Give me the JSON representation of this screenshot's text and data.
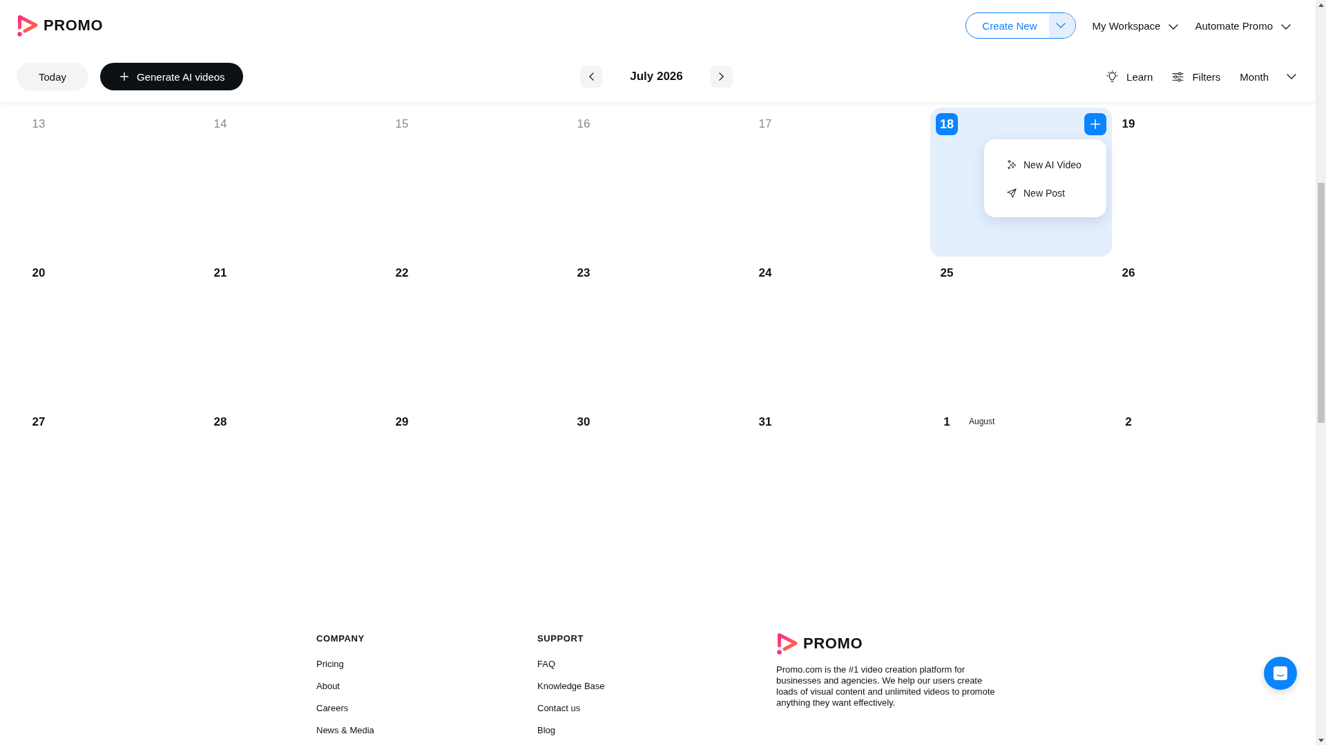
{
  "header": {
    "logo": "PROMO",
    "create_button": "Create New",
    "menus": [
      {
        "label": "My Workspace"
      },
      {
        "label": "Automate Promo"
      }
    ]
  },
  "toolbar": {
    "today_button": "Today",
    "generate_button": "Generate AI videos",
    "month_title": "July 2026",
    "actions": [
      {
        "kind": "learn",
        "label": "Learn"
      },
      {
        "kind": "filters",
        "label": "Filters"
      }
    ],
    "view_select": "Month"
  },
  "calendar": {
    "weeks": [
      {
        "days": [
          {
            "day": "13",
            "past": true,
            "today": false,
            "selected": false
          },
          {
            "day": "14",
            "past": true,
            "today": false,
            "selected": false
          },
          {
            "day": "15",
            "past": true,
            "today": false,
            "selected": false
          },
          {
            "day": "16",
            "past": true,
            "today": false,
            "selected": false
          },
          {
            "day": "17",
            "past": true,
            "today": false,
            "selected": false
          },
          {
            "day": "18",
            "past": false,
            "today": true,
            "selected": true,
            "menu": [
              {
                "kind": "ai_video",
                "label": "New AI Video"
              },
              {
                "kind": "post",
                "label": "New Post"
              }
            ]
          },
          {
            "day": "19",
            "past": false,
            "today": false,
            "selected": false
          }
        ]
      },
      {
        "days": [
          {
            "day": "20",
            "past": false,
            "today": false,
            "selected": false
          },
          {
            "day": "21",
            "past": false,
            "today": false,
            "selected": false
          },
          {
            "day": "22",
            "past": false,
            "today": false,
            "selected": false
          },
          {
            "day": "23",
            "past": false,
            "today": false,
            "selected": false
          },
          {
            "day": "24",
            "past": false,
            "today": false,
            "selected": false
          },
          {
            "day": "25",
            "past": false,
            "today": false,
            "selected": false
          },
          {
            "day": "26",
            "past": false,
            "today": false,
            "selected": false
          }
        ]
      },
      {
        "days": [
          {
            "day": "27",
            "past": false,
            "today": false,
            "selected": false
          },
          {
            "day": "28",
            "past": false,
            "today": false,
            "selected": false
          },
          {
            "day": "29",
            "past": false,
            "today": false,
            "selected": false
          },
          {
            "day": "30",
            "past": false,
            "today": false,
            "selected": false
          },
          {
            "day": "31",
            "past": false,
            "today": false,
            "selected": false
          },
          {
            "day": "1",
            "past": false,
            "today": false,
            "selected": false,
            "month_label": "August"
          },
          {
            "day": "2",
            "past": false,
            "today": false,
            "selected": false
          }
        ]
      }
    ]
  },
  "footer": {
    "columns": [
      {
        "heading": "COMPANY",
        "links": [
          "Pricing",
          "About",
          "Careers",
          "News & Media"
        ]
      },
      {
        "heading": "SUPPORT",
        "links": [
          "FAQ",
          "Knowledge Base",
          "Contact us",
          "Blog"
        ]
      }
    ],
    "brand": {
      "logo": "PROMO",
      "description": "Promo.com is the #1 video creation platform for businesses and agencies. We help our users create loads of visual content and unlimited videos to promote anything they want effectively."
    }
  }
}
